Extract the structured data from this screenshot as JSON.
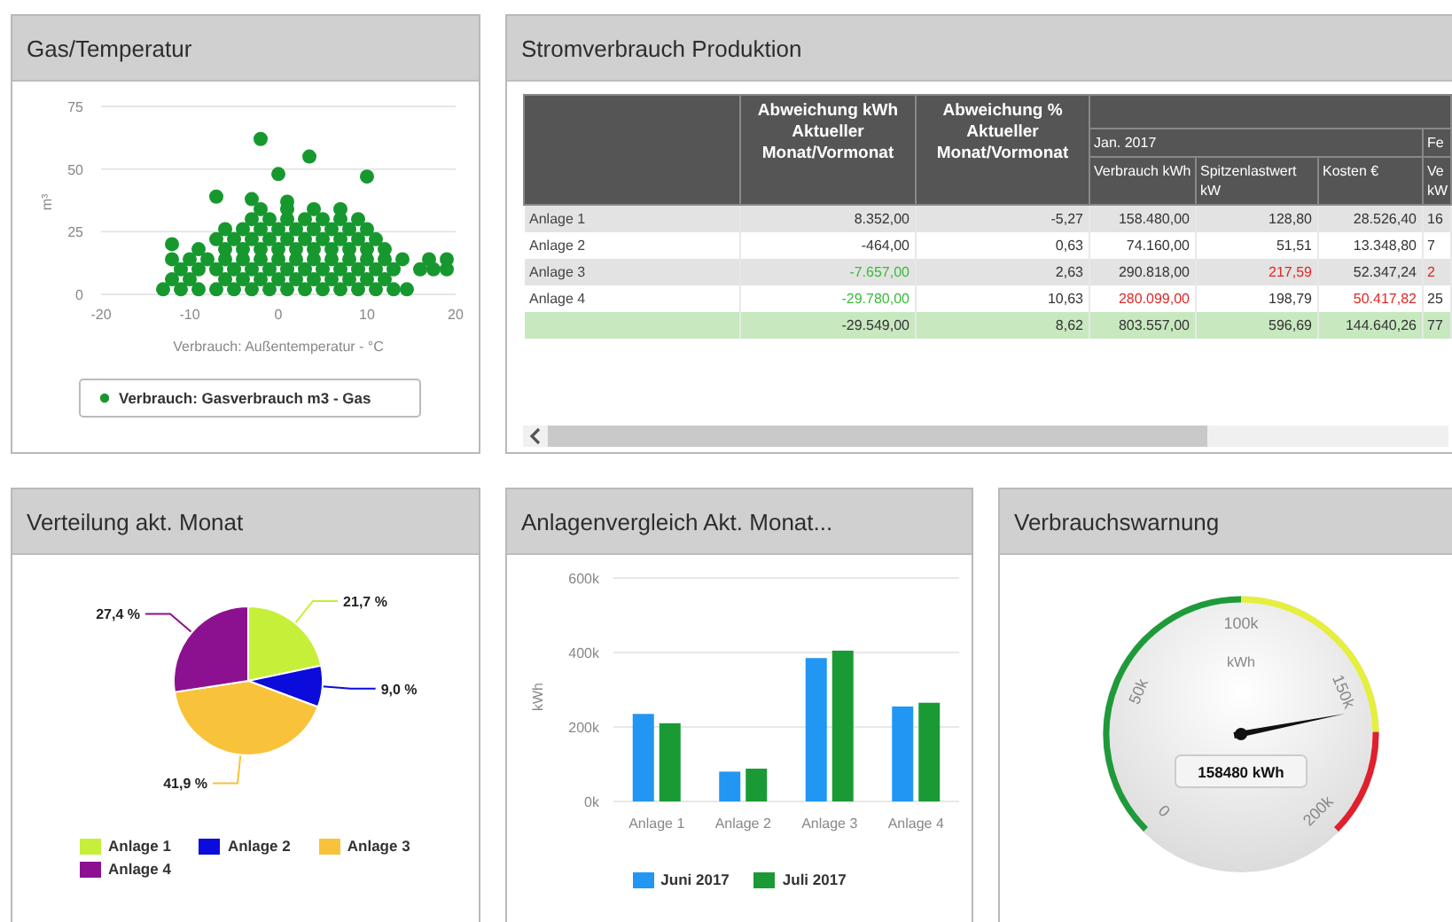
{
  "panels": [
    {
      "kind": "chart",
      "title": "Gas/Temperatur",
      "chart_data": {
        "type": "scatter",
        "xlabel": "Verbrauch: Außentemperatur - °C",
        "ylabel": "m³",
        "xlim": [
          -20,
          20
        ],
        "ylim": [
          0,
          75
        ],
        "xticks": [
          {
            "value": -20,
            "label": "-20"
          },
          {
            "value": -10,
            "label": "-10"
          },
          {
            "value": 0,
            "label": "0"
          },
          {
            "value": 10,
            "label": "10"
          },
          {
            "value": 20,
            "label": "20"
          }
        ],
        "yticks": [
          {
            "value": 0,
            "label": "0"
          },
          {
            "value": 25,
            "label": "25"
          },
          {
            "value": 50,
            "label": "50"
          },
          {
            "value": 75,
            "label": "75"
          }
        ],
        "x": [
          -13,
          -11,
          -9,
          -7,
          -5,
          -3,
          -1,
          1,
          3,
          5,
          7,
          9,
          11,
          13,
          14.5,
          -12,
          -10,
          -6,
          -4,
          -2,
          0,
          2,
          4,
          6,
          8,
          10,
          12,
          -11,
          -9,
          -7,
          -5,
          -3,
          -1,
          1,
          3,
          5,
          7,
          9,
          11,
          13,
          16,
          17.5,
          19,
          -12,
          -10,
          -8,
          -6,
          -4,
          -2,
          0,
          2,
          4,
          6,
          8,
          10,
          12,
          14,
          17,
          19,
          -9,
          -6,
          -4,
          -2,
          0,
          2,
          4,
          6,
          8,
          10,
          12,
          -7,
          -5,
          -3,
          -1,
          1,
          3,
          5,
          7,
          9,
          11,
          -6,
          -4,
          -2,
          0,
          2,
          4,
          6,
          8,
          10,
          -3,
          -1,
          1,
          3,
          5,
          7,
          9,
          -2,
          1,
          4,
          7,
          -12,
          -7,
          -2,
          3.5,
          0,
          10,
          -3,
          1
        ],
        "series": [
          {
            "name": "Verbrauch: Gasverbrauch m3 - Gas",
            "color": "#17982f",
            "values": [
              2,
              2,
              2,
              2,
              2,
              2,
              2,
              2,
              2,
              2,
              2,
              2,
              2,
              2,
              2,
              6,
              6,
              6,
              6,
              6,
              6,
              6,
              6,
              6,
              6,
              6,
              6,
              10,
              10,
              10,
              10,
              10,
              10,
              10,
              10,
              10,
              10,
              10,
              10,
              10,
              10,
              10,
              10,
              14,
              14,
              14,
              14,
              14,
              14,
              14,
              14,
              14,
              14,
              14,
              14,
              14,
              14,
              14,
              14,
              18,
              18,
              18,
              18,
              18,
              18,
              18,
              18,
              18,
              18,
              18,
              22,
              22,
              22,
              22,
              22,
              22,
              22,
              22,
              22,
              22,
              26,
              26,
              26,
              26,
              26,
              26,
              26,
              26,
              26,
              30,
              30,
              30,
              30,
              30,
              30,
              30,
              34,
              34,
              34,
              34,
              20,
              39,
              62,
              55,
              48,
              47,
              38,
              37
            ]
          }
        ]
      }
    },
    {
      "kind": "table",
      "title": "Stromverbrauch Produktion",
      "table": {
        "fixed_columns": [
          "Abweichung kWh Aktueller Monat/Vormonat",
          "Abweichung % Aktueller Monat/Vormonat"
        ],
        "month_groups": [
          {
            "label": "Jan. 2017",
            "columns": [
              "Verbrauch kWh",
              "Spitzenlastwert kW",
              "Kosten €"
            ]
          },
          {
            "label": "Fe",
            "columns": [
              "Ve kW"
            ]
          }
        ],
        "rows": [
          {
            "kind": "item",
            "label": "Anlage 1",
            "cells": [
              {
                "text": "8.352,00",
                "color": "#333333"
              },
              {
                "text": "-5,27",
                "color": "#333333"
              },
              {
                "text": "158.480,00",
                "color": "#333333"
              },
              {
                "text": "128,80",
                "color": "#333333"
              },
              {
                "text": "28.526,40",
                "color": "#333333"
              },
              {
                "text": "16",
                "color": "#333333"
              }
            ]
          },
          {
            "kind": "item",
            "label": "Anlage 2",
            "cells": [
              {
                "text": "-464,00",
                "color": "#333333"
              },
              {
                "text": "0,63",
                "color": "#333333"
              },
              {
                "text": "74.160,00",
                "color": "#333333"
              },
              {
                "text": "51,51",
                "color": "#333333"
              },
              {
                "text": "13.348,80",
                "color": "#333333"
              },
              {
                "text": "7",
                "color": "#333333"
              }
            ]
          },
          {
            "kind": "item",
            "label": "Anlage 3",
            "cells": [
              {
                "text": "-7.657,00",
                "color": "#3cb93c"
              },
              {
                "text": "2,63",
                "color": "#333333"
              },
              {
                "text": "290.818,00",
                "color": "#333333"
              },
              {
                "text": "217,59",
                "color": "#e02828"
              },
              {
                "text": "52.347,24",
                "color": "#333333"
              },
              {
                "text": "2",
                "color": "#e02828"
              }
            ]
          },
          {
            "kind": "item",
            "label": "Anlage 4",
            "cells": [
              {
                "text": "-29.780,00",
                "color": "#3cb93c"
              },
              {
                "text": "10,63",
                "color": "#333333"
              },
              {
                "text": "280.099,00",
                "color": "#e02828"
              },
              {
                "text": "198,79",
                "color": "#333333"
              },
              {
                "text": "50.417,82",
                "color": "#e02828"
              },
              {
                "text": "25",
                "color": "#333333"
              }
            ]
          },
          {
            "kind": "total",
            "cells": [
              {
                "text": "-29.549,00",
                "color": "#333333"
              },
              {
                "text": "8,62",
                "color": "#333333"
              },
              {
                "text": "803.557,00",
                "color": "#333333"
              },
              {
                "text": "596,69",
                "color": "#333333"
              },
              {
                "text": "144.640,26",
                "color": "#333333"
              },
              {
                "text": "77",
                "color": "#333333"
              }
            ]
          }
        ]
      }
    },
    {
      "kind": "chart",
      "title": "Verteilung akt. Monat",
      "chart_data": {
        "type": "pie",
        "categories": [
          "Anlage 1",
          "Anlage 2",
          "Anlage 3",
          "Anlage 4"
        ],
        "values": [
          21.7,
          9.0,
          41.9,
          27.4
        ],
        "colors": [
          "#c6ef3a",
          "#0b0bdc",
          "#f8c23a",
          "#8c1190"
        ],
        "value_labels": [
          "21,7 %",
          "9,0 %",
          "41,9 %",
          "27,4 %"
        ]
      }
    },
    {
      "kind": "chart",
      "title": "Anlagenvergleich Akt. Monat...",
      "chart_data": {
        "type": "bar",
        "ylabel": "kWh",
        "categories": [
          "Anlage 1",
          "Anlage 2",
          "Anlage 3",
          "Anlage 4"
        ],
        "ylim": [
          0,
          600000
        ],
        "yticks": [
          {
            "value": 0,
            "label": "0k"
          },
          {
            "value": 200000,
            "label": "200k"
          },
          {
            "value": 400000,
            "label": "400k"
          },
          {
            "value": 600000,
            "label": "600k"
          }
        ],
        "series": [
          {
            "name": "Juni 2017",
            "color": "#2196f3",
            "values": [
              235000,
              80000,
              385000,
              255000
            ]
          },
          {
            "name": "Juli 2017",
            "color": "#1a9a35",
            "values": [
              210000,
              88000,
              405000,
              265000
            ]
          }
        ]
      }
    },
    {
      "kind": "gauge",
      "title": "Verbrauchswarnung",
      "gauge": {
        "unit": "kWh",
        "reading": "158480 kWh",
        "tick_labels": [
          "0",
          "50k",
          "100k",
          "150k",
          "200k"
        ]
      }
    }
  ]
}
